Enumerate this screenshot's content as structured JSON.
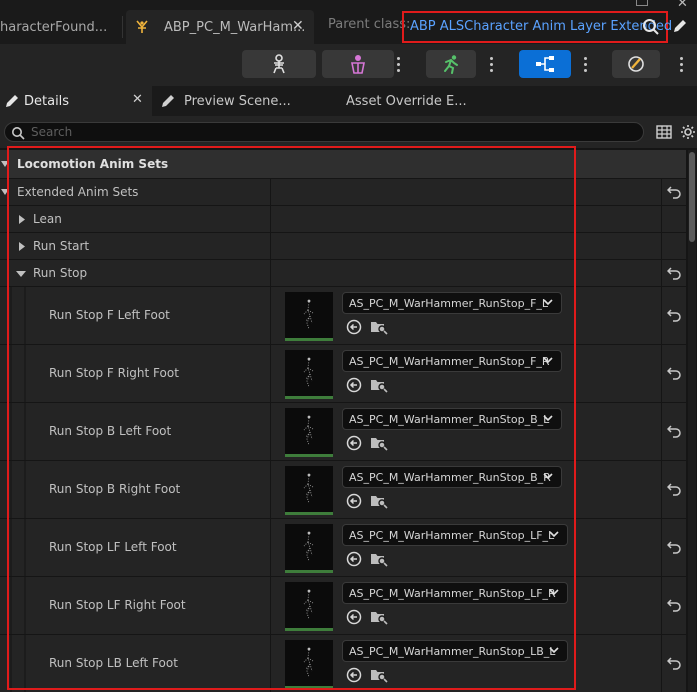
{
  "tabs": {
    "prev_tab_label": "haracterFound...",
    "active_tab_label": "ABP_PC_M_WarHam...",
    "parent_class_label": "Parent class:",
    "parent_class_value": "ABP ALSCharacter Anim Layer Extended"
  },
  "panels": {
    "details": "Details",
    "preview": "Preview Scene...",
    "asset_override": "Asset Override E..."
  },
  "search": {
    "placeholder": "Search"
  },
  "categories": {
    "locomotion": "Locomotion Anim Sets",
    "extended": "Extended Anim Sets",
    "lean": "Lean",
    "run_start": "Run Start",
    "run_stop": "Run Stop"
  },
  "properties": [
    {
      "label": "Run Stop F Left Foot",
      "asset": "AS_PC_M_WarHammer_RunStop_F_L"
    },
    {
      "label": "Run Stop F Right Foot",
      "asset": "AS_PC_M_WarHammer_RunStop_F_R"
    },
    {
      "label": "Run Stop B Left Foot",
      "asset": "AS_PC_M_WarHammer_RunStop_B_L"
    },
    {
      "label": "Run Stop B Right Foot",
      "asset": "AS_PC_M_WarHammer_RunStop_B_R"
    },
    {
      "label": "Run Stop LF Left Foot",
      "asset": "AS_PC_M_WarHammer_RunStop_LF_L"
    },
    {
      "label": "Run Stop LF Right Foot",
      "asset": "AS_PC_M_WarHammer_RunStop_LF_R"
    },
    {
      "label": "Run Stop LB Left Foot",
      "asset": "AS_PC_M_WarHammer_RunStop_LB_L"
    }
  ],
  "colors": {
    "highlight": "#e01b1b",
    "link": "#5aa2ff",
    "accent": "#0b6fd6",
    "thumb_bar": "#3e7d3b"
  }
}
